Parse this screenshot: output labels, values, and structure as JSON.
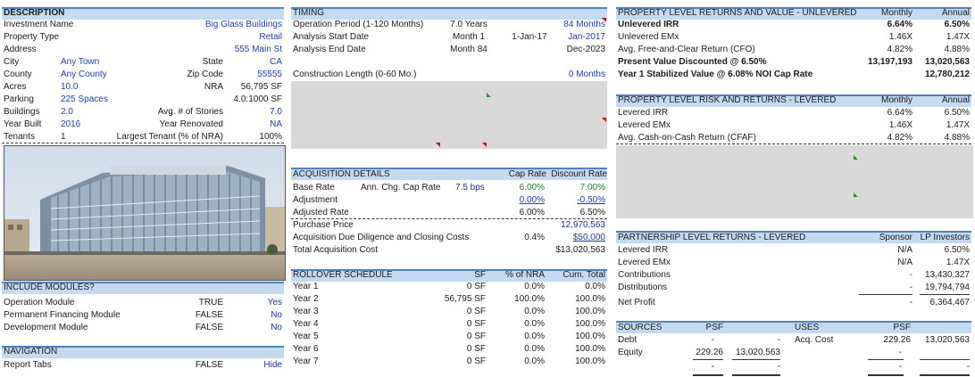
{
  "description": {
    "header": "DESCRIPTION",
    "rows": [
      {
        "label": "Investment Name",
        "value": "Big Glass Buildings"
      },
      {
        "label": "Property Type",
        "value": "Retail"
      },
      {
        "label": "Address",
        "value": "555 Main St"
      },
      {
        "label": "City",
        "value": "Any Town",
        "label2": "State",
        "value2": "CA"
      },
      {
        "label": "County",
        "value": "Any County",
        "label2": "Zip Code",
        "value2": "55555"
      },
      {
        "label": "Acres",
        "value": "10.0",
        "label2": "NRA",
        "value2": "56,795 SF"
      },
      {
        "label": "Parking",
        "value": "225 Spaces",
        "value2": "4.0:1000 SF"
      },
      {
        "label": "Buildings",
        "value": "2.0",
        "label2": "Avg. # of Stories",
        "value2": "7.0"
      },
      {
        "label": "Year Built",
        "value": "2016",
        "label2": "Year Renovated",
        "value2": "NA"
      },
      {
        "label": "Tenants",
        "value": "1",
        "label2": "Largest Tenant (% of NRA)",
        "value2": "100%"
      }
    ]
  },
  "include_modules": {
    "header": "INCLUDE MODULES?",
    "rows": [
      {
        "label": "Operation Module",
        "flag": "TRUE",
        "value": "Yes"
      },
      {
        "label": "Permanent Financing Module",
        "flag": "FALSE",
        "value": "No"
      },
      {
        "label": "Development Module",
        "flag": "FALSE",
        "value": "No"
      }
    ]
  },
  "navigation": {
    "header": "NAVIGATION",
    "rows": [
      {
        "label": "Report Tabs",
        "flag": "FALSE",
        "value": "Hide"
      }
    ]
  },
  "timing": {
    "header": "TIMING",
    "rows": [
      {
        "label": "Operation Period (1-120 Months)",
        "c1": "7.0 Years",
        "c2": "",
        "c3": "84 Months"
      },
      {
        "label": "Analysis Start Date",
        "c1": "Month 1",
        "c2": "1-Jan-17",
        "c3": "Jan-2017"
      },
      {
        "label": "Analysis End Date",
        "c1": "Month 84",
        "c2": "",
        "c3": "Dec-2023"
      }
    ],
    "construction_label": "Construction Length (0-60 Mo.)",
    "construction_value": "0 Months"
  },
  "acquisition": {
    "header": "ACQUISITION DETAILS",
    "col1": "Cap Rate",
    "col2": "Discount Rate",
    "base_rate": {
      "label": "Base Rate",
      "sub": "Ann. Chg. Cap Rate",
      "sub_value": "7.5 bps",
      "cap": "6.00%",
      "disc": "7.00%"
    },
    "adjustment": {
      "label": "Adjustment",
      "cap": "0.00%",
      "disc": "-0.50%"
    },
    "adjusted": {
      "label": "Adjusted Rate",
      "cap": "6.00%",
      "disc": "6.50%"
    },
    "purchase_price": {
      "label": "Purchase Price",
      "value": "12,970,563"
    },
    "due_diligence": {
      "label": "Acquisition Due Diligence and Closing Costs",
      "pct": "0.4%",
      "value": "$50,000"
    },
    "total": {
      "label": "Total Acquisition Cost",
      "value": "$13,020,563"
    }
  },
  "rollover": {
    "header": "ROLLOVER SCHEDULE",
    "cols": [
      "SF",
      "% of NRA",
      "Cum. Total"
    ],
    "rows": [
      {
        "label": "Year 1",
        "sf": "0 SF",
        "pct": "0.0%",
        "cum": "0.0%"
      },
      {
        "label": "Year 2",
        "sf": "56,795 SF",
        "pct": "100.0%",
        "cum": "100.0%"
      },
      {
        "label": "Year 3",
        "sf": "0 SF",
        "pct": "0.0%",
        "cum": "100.0%"
      },
      {
        "label": "Year 4",
        "sf": "0 SF",
        "pct": "0.0%",
        "cum": "100.0%"
      },
      {
        "label": "Year 5",
        "sf": "0 SF",
        "pct": "0.0%",
        "cum": "100.0%"
      },
      {
        "label": "Year 6",
        "sf": "0 SF",
        "pct": "0.0%",
        "cum": "100.0%"
      },
      {
        "label": "Year 7",
        "sf": "0 SF",
        "pct": "0.0%",
        "cum": "100.0%"
      }
    ]
  },
  "unlevered": {
    "header": "PROPERTY LEVEL RETURNS AND VALUE - UNLEVERED",
    "col1": "Monthly",
    "col2": "Annual",
    "rows": [
      {
        "label": "Unlevered IRR",
        "m": "6.64%",
        "a": "6.50%",
        "bold": true
      },
      {
        "label": "Unlevered EMx",
        "m": "1.46X",
        "a": "1.47X",
        "bold": false
      },
      {
        "label": "Avg. Free-and-Clear Return (CFO)",
        "m": "4.82%",
        "a": "4.88%",
        "bold": false
      },
      {
        "label": "Present Value Discounted @ 6.50%",
        "m": "13,197,193",
        "a": "13,020,563",
        "bold": true
      },
      {
        "label": "Year 1 Stabilized Value @ 6.08% NOI Cap Rate",
        "m": "",
        "a": "12,780,212",
        "bold": true
      }
    ]
  },
  "levered": {
    "header": "PROPERTY LEVEL RISK AND RETURNS - LEVERED",
    "col1": "Monthly",
    "col2": "Annual",
    "rows": [
      {
        "label": "Levered IRR",
        "m": "6.64%",
        "a": "6.50%"
      },
      {
        "label": "Levered EMx",
        "m": "1.46X",
        "a": "1.47X"
      },
      {
        "label": "Avg. Cash-on-Cash Return (CFAF)",
        "m": "4.82%",
        "a": "4.88%"
      }
    ]
  },
  "partnership": {
    "header": "PARTNERSHIP LEVEL RETURNS - LEVERED",
    "col1": "Sponsor",
    "col2": "LP Investors",
    "rows": [
      {
        "label": "Levered IRR",
        "s": "N/A",
        "l": "6.50%"
      },
      {
        "label": "Levered EMx",
        "s": "N/A",
        "l": "1.47X"
      },
      {
        "label": "Contributions",
        "s": "-",
        "l": "13,430,327"
      },
      {
        "label": "Distributions",
        "s": "-",
        "l": "19,794,794"
      },
      {
        "label": "Net Profit",
        "s": "-",
        "l": "6,364,467"
      }
    ]
  },
  "sources": {
    "header": "SOURCES",
    "psf": "PSF",
    "rows": [
      {
        "label": "Debt",
        "psf": "-",
        "amt": "-"
      },
      {
        "label": "Equity",
        "psf": "229.26",
        "amt": "13,020,563"
      },
      {
        "label": "",
        "psf": "-",
        "amt": "-"
      }
    ]
  },
  "uses": {
    "header": "USES",
    "psf": "PSF",
    "rows": [
      {
        "label": "Acq. Cost",
        "psf": "229.26",
        "amt": "13,020,563"
      },
      {
        "label": "",
        "psf": "-",
        "amt": ""
      },
      {
        "label": "",
        "psf": "-",
        "amt": "-"
      }
    ]
  },
  "photo": {
    "alt": "glass-office-building"
  },
  "colors": {
    "header_bg": "#c5d9f1",
    "header_border": "#4f81bd",
    "input_blue": "#1f3fa0",
    "input_green": "#1e7b1e",
    "gray_block": "#d9d9d9"
  }
}
